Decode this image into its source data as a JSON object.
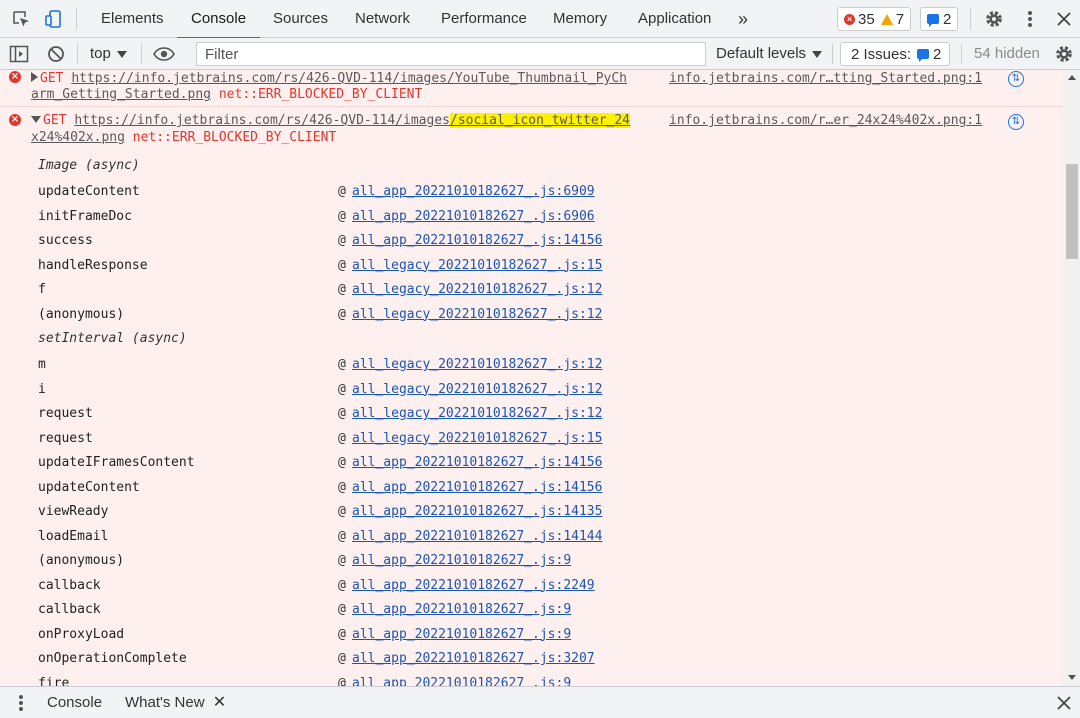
{
  "toolbar": {
    "tabs": [
      "Elements",
      "Console",
      "Sources",
      "Network",
      "Performance",
      "Memory",
      "Application"
    ],
    "more_tabs": "»",
    "error_count": "35",
    "warning_count": "7",
    "message_count": "2"
  },
  "filterbar": {
    "context": "top",
    "filter_placeholder": "Filter",
    "levels": "Default levels",
    "issues_label": "2 Issues:",
    "issues_count": "2",
    "hidden": "54 hidden"
  },
  "entries": [
    {
      "method": "GET",
      "url_line1": "https://info.jetbrains.com/rs/426-QVD-114/images/YouTube_Thumbnail_PyCh",
      "url_line2": "arm_Getting_Started.png",
      "error": "net::ERR_BLOCKED_BY_CLIENT",
      "source": "info.jetbrains.com/r…tting_Started.png:1"
    },
    {
      "method": "GET",
      "url_line1_prefix": "https://info.jetbrains.com/rs/426-QVD-114/images",
      "url_line1_highlight": "/social_icon_twitter_24",
      "url_line2": "x24%402x.png",
      "error": "net::ERR_BLOCKED_BY_CLIENT",
      "source": "info.jetbrains.com/r…er_24x24%402x.png:1"
    }
  ],
  "stack": [
    {
      "fn": "Image (async)",
      "async": true
    },
    {
      "fn": "updateContent",
      "loc": "all_app_20221010182627_.js:6909"
    },
    {
      "fn": "initFrameDoc",
      "loc": "all_app_20221010182627_.js:6906"
    },
    {
      "fn": "success",
      "loc": "all_app_20221010182627_.js:14156"
    },
    {
      "fn": "handleResponse",
      "loc": "all_legacy_20221010182627_.js:15"
    },
    {
      "fn": "f",
      "loc": "all_legacy_20221010182627_.js:12"
    },
    {
      "fn": "(anonymous)",
      "loc": "all_legacy_20221010182627_.js:12"
    },
    {
      "fn": "setInterval (async)",
      "async": true
    },
    {
      "fn": "m",
      "loc": "all_legacy_20221010182627_.js:12"
    },
    {
      "fn": "i",
      "loc": "all_legacy_20221010182627_.js:12"
    },
    {
      "fn": "request",
      "loc": "all_legacy_20221010182627_.js:12"
    },
    {
      "fn": "request",
      "loc": "all_legacy_20221010182627_.js:15"
    },
    {
      "fn": "updateIFramesContent",
      "loc": "all_app_20221010182627_.js:14156"
    },
    {
      "fn": "updateContent",
      "loc": "all_app_20221010182627_.js:14156"
    },
    {
      "fn": "viewReady",
      "loc": "all_app_20221010182627_.js:14135"
    },
    {
      "fn": "loadEmail",
      "loc": "all_app_20221010182627_.js:14144"
    },
    {
      "fn": "(anonymous)",
      "loc": "all_app_20221010182627_.js:9"
    },
    {
      "fn": "callback",
      "loc": "all_app_20221010182627_.js:2249"
    },
    {
      "fn": "callback",
      "loc": "all_app_20221010182627_.js:9"
    },
    {
      "fn": "onProxyLoad",
      "loc": "all_app_20221010182627_.js:9"
    },
    {
      "fn": "onOperationComplete",
      "loc": "all_app_20221010182627_.js:3207"
    },
    {
      "fn": "fire",
      "loc": "all_app_20221010182627_.js:9"
    }
  ],
  "drawer": {
    "tabs": [
      "Console",
      "What's New"
    ]
  }
}
